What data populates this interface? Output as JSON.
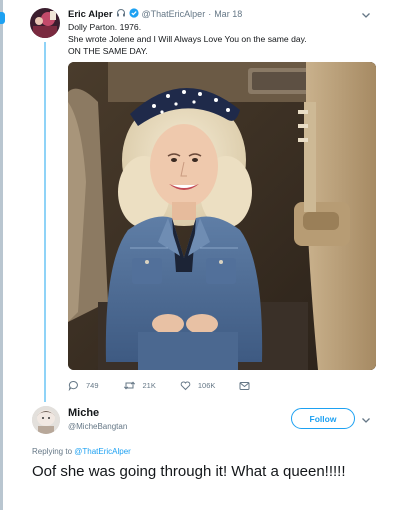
{
  "tweet": {
    "author_name": "Eric Alper",
    "author_handle": "@ThatEricAlper",
    "separator": "·",
    "date": "Mar 18",
    "lines": [
      "Dolly Parton. 1976.",
      "She wrote Jolene and I Will Always Love You on the same day.",
      "ON THE SAME DAY."
    ],
    "actions": {
      "replies": "749",
      "retweets": "21K",
      "likes": "106K"
    },
    "icons": [
      "verified-badge-icon",
      "headphones-icon",
      "reply-icon",
      "retweet-icon",
      "like-icon",
      "message-icon",
      "chevron-down-icon"
    ]
  },
  "reply": {
    "author_name": "Miche",
    "author_handle": "@MicheBangtan",
    "follow_label": "Follow",
    "replying_prefix": "Replying to",
    "replying_to": "@ThatEricAlper",
    "text": "Oof she was going through it! What a queen!!!!!"
  },
  "colors": {
    "accent": "#1da1f2",
    "thread_line": "#8fd3f7",
    "muted": "#657786",
    "text": "#14171a"
  }
}
